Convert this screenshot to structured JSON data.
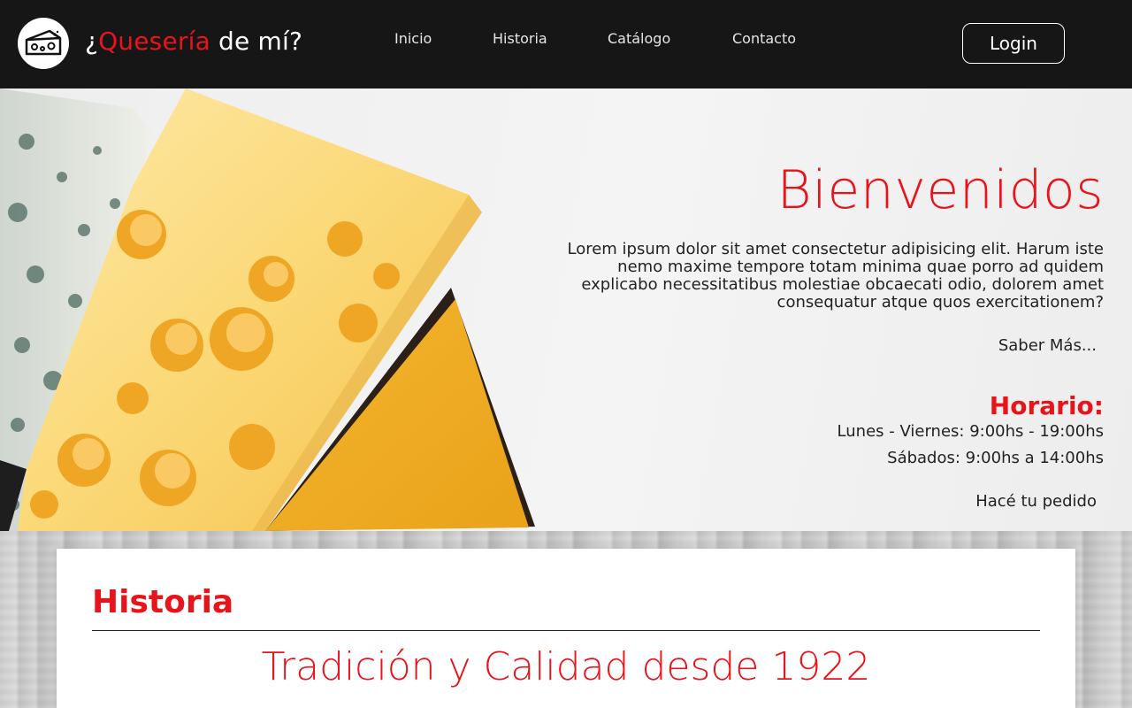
{
  "header": {
    "brand_prefix": "¿",
    "brand_highlight": "Quesería",
    "brand_suffix": " de mí?",
    "logo_icon": "cheese-icon",
    "nav": [
      {
        "label": "Inicio"
      },
      {
        "label": "Historia"
      },
      {
        "label": "Catálogo"
      },
      {
        "label": "Contacto"
      }
    ],
    "login_label": "Login"
  },
  "hero": {
    "title": "Bienvenidos",
    "text": "Lorem ipsum dolor sit amet consectetur adipisicing elit. Harum iste nemo maxime tempore totam minima quae porro ad quidem explicabo necessitatibus molestiae obcaecati odio, dolorem amet consequatur atque quos exercitationem?",
    "more_link": "Saber Más...",
    "hours_title": "Horario:",
    "hours": [
      "Lunes - Viernes: 9:00hs - 19:00hs",
      "Sábados: 9:00hs a 14:00hs"
    ],
    "order_link": "Hacé tu pedido"
  },
  "historia": {
    "title": "Historia",
    "subtitle": "Tradición y Calidad desde 1922"
  },
  "colors": {
    "accent": "#e8141b",
    "navbar_bg": "#161616"
  }
}
